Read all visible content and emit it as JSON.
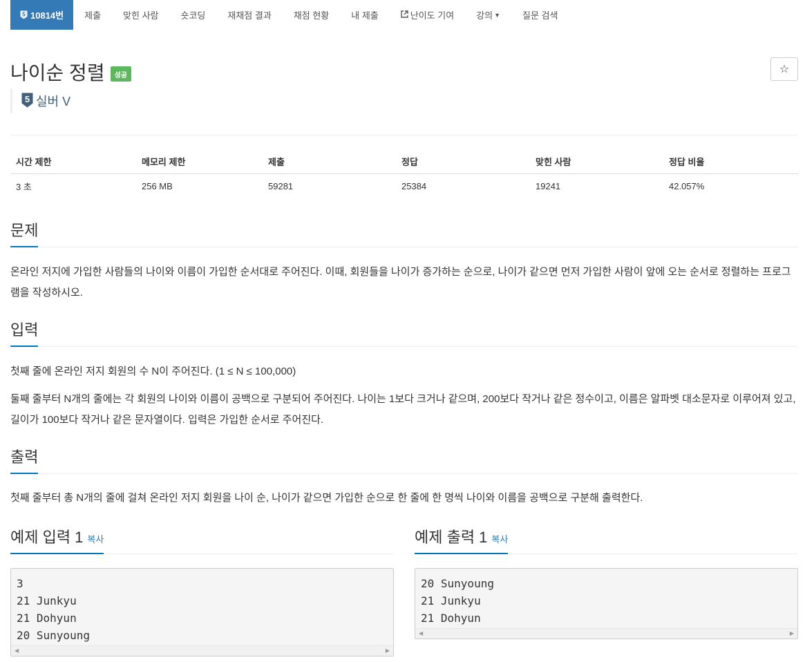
{
  "nav": {
    "problem_id": "10814번",
    "tier_number": "5",
    "items": [
      "제출",
      "맞힌 사람",
      "숏코딩",
      "재채점 결과",
      "채점 현황",
      "내 제출",
      "난이도 기여",
      "강의",
      "질문 검색"
    ]
  },
  "problem": {
    "title": "나이순 정렬",
    "status_badge": "성공",
    "star": "☆",
    "tier": {
      "number": "5",
      "label": "실버 V"
    }
  },
  "info": {
    "headers": [
      "시간 제한",
      "메모리 제한",
      "제출",
      "정답",
      "맞힌 사람",
      "정답 비율"
    ],
    "values": [
      "3 초",
      "256 MB",
      "59281",
      "25384",
      "19241",
      "42.057%"
    ]
  },
  "sections": {
    "description": {
      "heading": "문제",
      "text": "온라인 저지에 가입한 사람들의 나이와 이름이 가입한 순서대로 주어진다. 이때, 회원들을 나이가 증가하는 순으로, 나이가 같으면 먼저 가입한 사람이 앞에 오는 순서로 정렬하는 프로그램을 작성하시오."
    },
    "input": {
      "heading": "입력",
      "text1": "첫째 줄에 온라인 저지 회원의 수 N이 주어진다. (1 ≤ N ≤ 100,000)",
      "text2": "둘째 줄부터 N개의 줄에는 각 회원의 나이와 이름이 공백으로 구분되어 주어진다. 나이는 1보다 크거나 같으며, 200보다 작거나 같은 정수이고, 이름은 알파벳 대소문자로 이루어져 있고, 길이가 100보다 작거나 같은 문자열이다. 입력은 가입한 순서로 주어진다."
    },
    "output": {
      "heading": "출력",
      "text": "첫째 줄부터 총 N개의 줄에 걸쳐 온라인 저지 회원을 나이 순, 나이가 같으면 가입한 순으로 한 줄에 한 명씩 나이와 이름을 공백으로 구분해 출력한다."
    }
  },
  "samples": {
    "input": {
      "heading": "예제 입력 1",
      "copy": "복사",
      "content": "3\n21 Junkyu\n21 Dohyun\n20 Sunyoung"
    },
    "output": {
      "heading": "예제 출력 1",
      "copy": "복사",
      "content": "20 Sunyoung\n21 Junkyu\n21 Dohyun"
    }
  },
  "colors": {
    "nav_active": "#337ab7",
    "badge_success": "#5cb85c",
    "tier_silver": "#435f7a",
    "heading_underline": "#0076c0"
  }
}
